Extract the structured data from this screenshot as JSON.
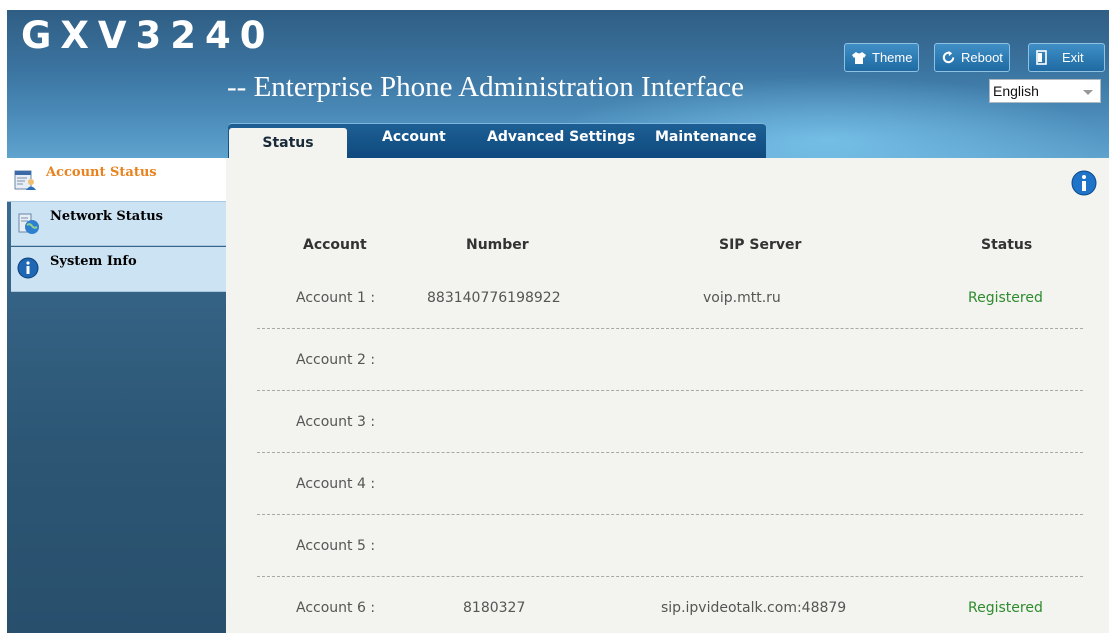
{
  "header": {
    "logo": "GXV3240",
    "subtitle": "-- Enterprise Phone Administration Interface",
    "buttons": {
      "theme": "Theme",
      "reboot": "Reboot",
      "exit": "Exit"
    },
    "language": "English"
  },
  "tabs": [
    {
      "label": "Status",
      "active": true
    },
    {
      "label": "Account"
    },
    {
      "label": "Advanced Settings"
    },
    {
      "label": "Maintenance"
    }
  ],
  "sidebar": {
    "items": [
      {
        "label": "Account Status",
        "icon": "account-status-icon",
        "active": true
      },
      {
        "label": "Network Status",
        "icon": "network-globe-icon"
      },
      {
        "label": "System Info",
        "icon": "info-icon"
      }
    ]
  },
  "table": {
    "headers": [
      "Account",
      "Number",
      "SIP Server",
      "Status"
    ],
    "rows": [
      {
        "account": "Account 1 :",
        "number": "883140776198922",
        "server": "voip.mtt.ru",
        "status": "Registered"
      },
      {
        "account": "Account 2 :",
        "number": "",
        "server": "",
        "status": ""
      },
      {
        "account": "Account 3 :",
        "number": "",
        "server": "",
        "status": ""
      },
      {
        "account": "Account 4 :",
        "number": "",
        "server": "",
        "status": ""
      },
      {
        "account": "Account 5 :",
        "number": "",
        "server": "",
        "status": ""
      },
      {
        "account": "Account 6 :",
        "number": "8180327",
        "server": "sip.ipvideotalk.com:48879",
        "status": "Registered"
      }
    ]
  },
  "colors": {
    "accent_orange": "#e8821e",
    "registered_green": "#2e8b2e",
    "header_blue": "#3b74a0"
  }
}
